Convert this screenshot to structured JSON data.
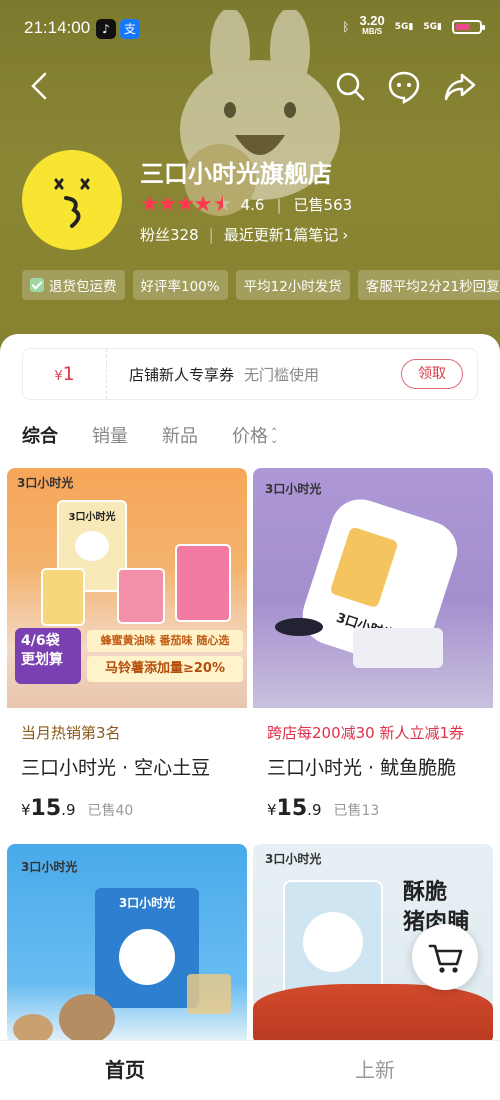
{
  "status": {
    "time": "21:14:00",
    "speed": "3.20",
    "speed_unit": "MB/S",
    "net1": "5G",
    "net2": "5G"
  },
  "shop": {
    "name": "三口小时光旗舰店",
    "rating": "4.6",
    "rating_stars": 4.5,
    "sold": "已售563",
    "fans": "粉丝328",
    "update": "最近更新1篇笔记",
    "tags": [
      "退货包运费",
      "好评率100%",
      "平均12小时发货",
      "客服平均2分21秒回复"
    ]
  },
  "coupon": {
    "currency": "¥",
    "amount": "1",
    "title": "店铺新人专享券",
    "subtitle": "无门槛使用",
    "button": "领取"
  },
  "sort_tabs": [
    "综合",
    "销量",
    "新品",
    "价格"
  ],
  "products": [
    {
      "badge": "当月热销第3名",
      "badge_color": "#8a5a1a",
      "name": "三口小时光 · 空心土豆",
      "price_int": "15",
      "price_dec": ".9",
      "sold": "已售40",
      "img_texts": {
        "brand": "3口小时光",
        "bag": "3口小时光",
        "promo": "4/6袋\n更划算",
        "flavors": "蜂蜜黄油味 番茄味 随心选",
        "boost": "马铃薯添加量≥20%"
      }
    },
    {
      "badge": "跨店每200减30  新人立减1券",
      "badge_color": "#e0304a",
      "name": "三口小时光 · 鱿鱼脆脆",
      "price_int": "15",
      "price_dec": ".9",
      "sold": "已售13",
      "img_texts": {
        "brand": "3口小时光",
        "bag": "3口小时光"
      }
    },
    {
      "img_texts": {
        "brand": "3口小时光",
        "box": "3口小时光"
      }
    },
    {
      "img_texts": {
        "brand": "3口小时光",
        "title": "酥脆\n猪肉脯"
      }
    }
  ],
  "bottom_tabs": [
    "首页",
    "上新"
  ],
  "colors": {
    "header": "#86822f",
    "accent": "#e03a4a",
    "star": "#ff3a4e",
    "avatar": "#f8e531"
  }
}
